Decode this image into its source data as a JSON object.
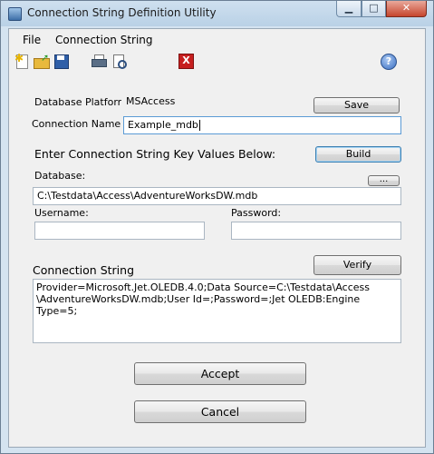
{
  "window": {
    "title": "Connection String Definition Utility",
    "minimize_glyph": "▁",
    "maximize_glyph": "□",
    "close_glyph": "✕"
  },
  "menu": {
    "file": "File",
    "connection_string": "Connection String"
  },
  "toolbar": {
    "icons": [
      "new-document-icon",
      "open-folder-icon",
      "save-disk-icon",
      "print-icon",
      "print-preview-icon",
      "exit-icon",
      "help-icon"
    ],
    "exit_glyph": "X",
    "help_glyph": "?"
  },
  "form": {
    "platform_label": "Database Platform",
    "platform_value": "MSAccess",
    "save_button": "Save",
    "name_label": "Connection Name",
    "name_value": "Example_mdb",
    "key_values_heading": "Enter Connection String Key Values Below:",
    "build_button": "Build",
    "database_label": "Database:",
    "browse_button": "...",
    "database_value": "C:\\Testdata\\Access\\AdventureWorksDW.mdb",
    "username_label": "Username:",
    "username_value": "",
    "password_label": "Password:",
    "password_value": "",
    "conn_string_label": "Connection String",
    "verify_button": "Verify",
    "conn_string_value": "Provider=Microsoft.Jet.OLEDB.4.0;Data Source=C:\\Testdata\\Access\n\\AdventureWorksDW.mdb;User Id=;Password=;Jet OLEDB:Engine Type=5;",
    "accept_button": "Accept",
    "cancel_button": "Cancel"
  },
  "colors": {
    "title_bar": "#b9d1e6",
    "close_button": "#c6452d",
    "default_button_border": "#3c7fb1",
    "exit_icon": "#c61f1f"
  }
}
